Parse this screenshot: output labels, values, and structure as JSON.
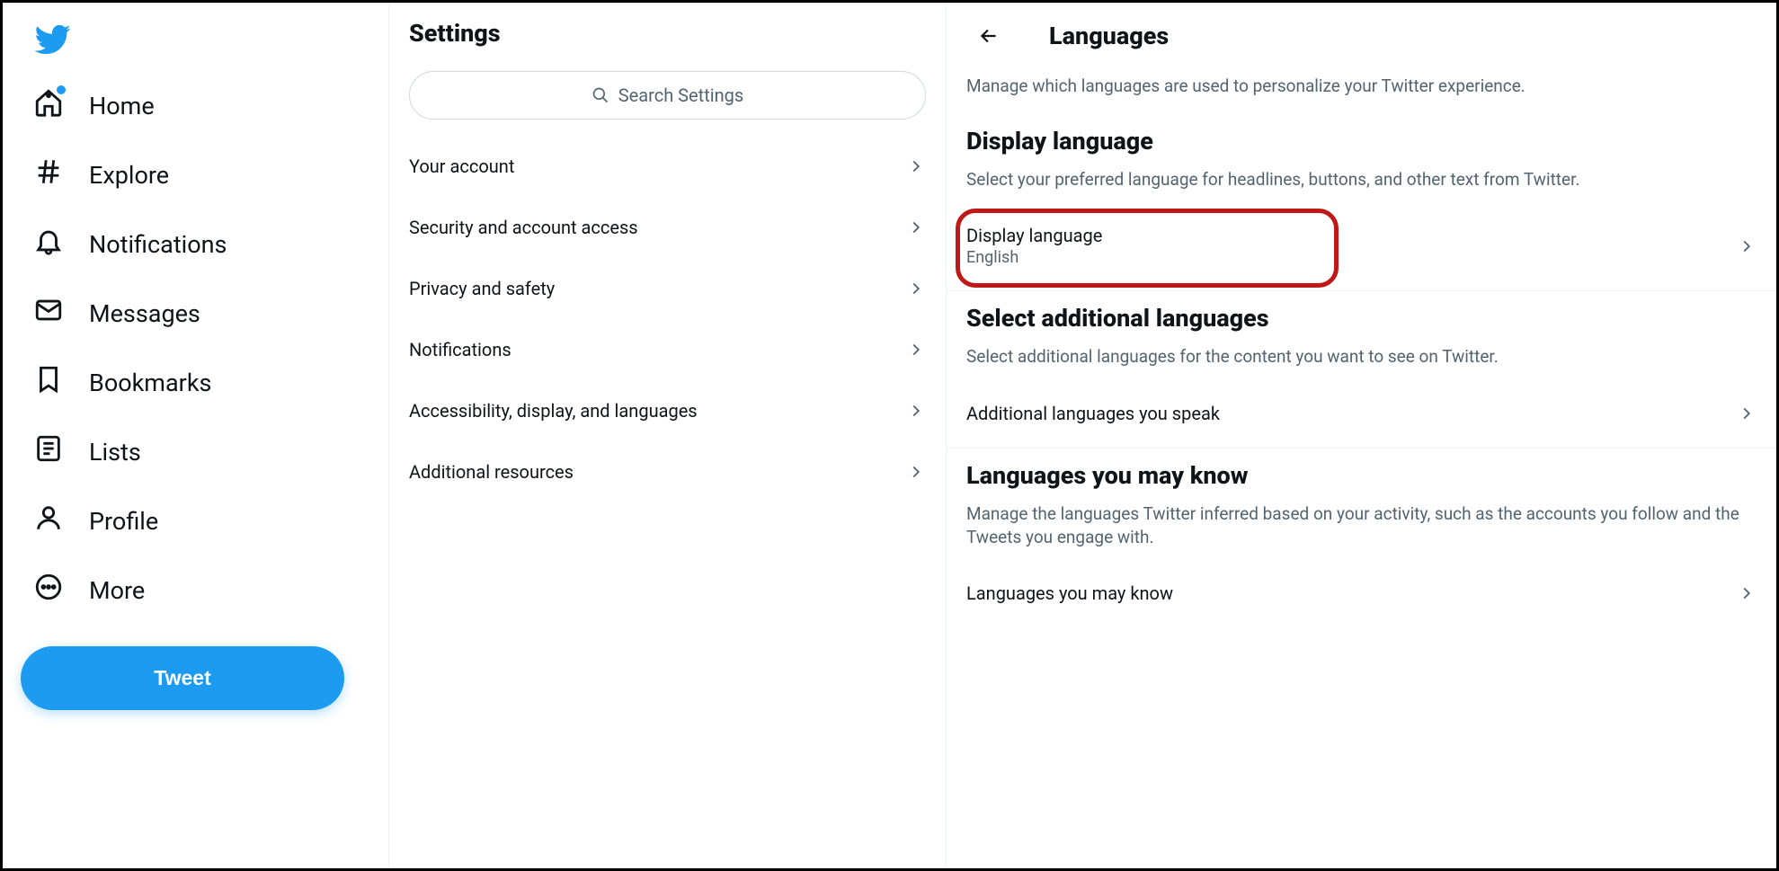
{
  "sidebar": {
    "items": [
      {
        "label": "Home"
      },
      {
        "label": "Explore"
      },
      {
        "label": "Notifications"
      },
      {
        "label": "Messages"
      },
      {
        "label": "Bookmarks"
      },
      {
        "label": "Lists"
      },
      {
        "label": "Profile"
      },
      {
        "label": "More"
      }
    ],
    "tweet_label": "Tweet"
  },
  "settings": {
    "title": "Settings",
    "search_placeholder": "Search Settings",
    "items": [
      {
        "label": "Your account"
      },
      {
        "label": "Security and account access"
      },
      {
        "label": "Privacy and safety"
      },
      {
        "label": "Notifications"
      },
      {
        "label": "Accessibility, display, and languages"
      },
      {
        "label": "Additional resources"
      }
    ]
  },
  "content": {
    "title": "Languages",
    "intro": "Manage which languages are used to personalize your Twitter experience.",
    "display": {
      "heading": "Display language",
      "desc": "Select your preferred language for headlines, buttons, and other text from Twitter.",
      "row_title": "Display language",
      "row_value": "English"
    },
    "additional": {
      "heading": "Select additional languages",
      "desc": "Select additional languages for the content you want to see on Twitter.",
      "row_title": "Additional languages you speak"
    },
    "mayknow": {
      "heading": "Languages you may know",
      "desc": "Manage the languages Twitter inferred based on your activity, such as the accounts you follow and the Tweets you engage with.",
      "row_title": "Languages you may know"
    }
  }
}
